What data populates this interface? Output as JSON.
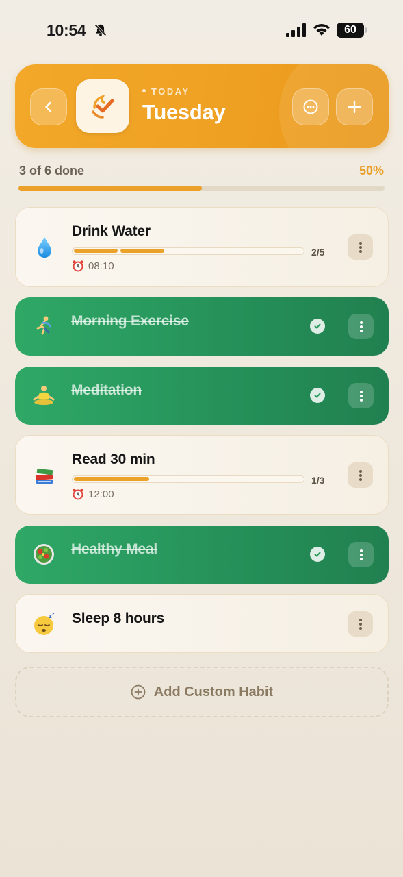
{
  "status_bar": {
    "time": "10:54",
    "battery": "60"
  },
  "header": {
    "eyebrow": "TODAY",
    "day": "Tuesday"
  },
  "progress": {
    "label": "3 of 6 done",
    "percent_label": "50%",
    "fraction": 0.5
  },
  "habits": [
    {
      "name": "Drink Water",
      "emoji": "droplet",
      "status": "pending",
      "count": "2/5",
      "progress": 0.4,
      "alarm": "08:10"
    },
    {
      "name": "Morning Exercise",
      "emoji": "person-running",
      "status": "done"
    },
    {
      "name": "Meditation",
      "emoji": "person-meditating",
      "status": "done"
    },
    {
      "name": "Read 30 min",
      "emoji": "books",
      "status": "pending",
      "count": "1/3",
      "progress": 0.333,
      "alarm": "12:00"
    },
    {
      "name": "Healthy Meal",
      "emoji": "salad",
      "status": "done"
    },
    {
      "name": "Sleep 8 hours",
      "emoji": "sleeping-face",
      "status": "pending"
    }
  ],
  "add_button": {
    "label": "Add Custom Habit"
  },
  "colors": {
    "accent": "#eba02a",
    "done_green": "#2a9a5e",
    "card_bg": "#f8f3ea"
  }
}
